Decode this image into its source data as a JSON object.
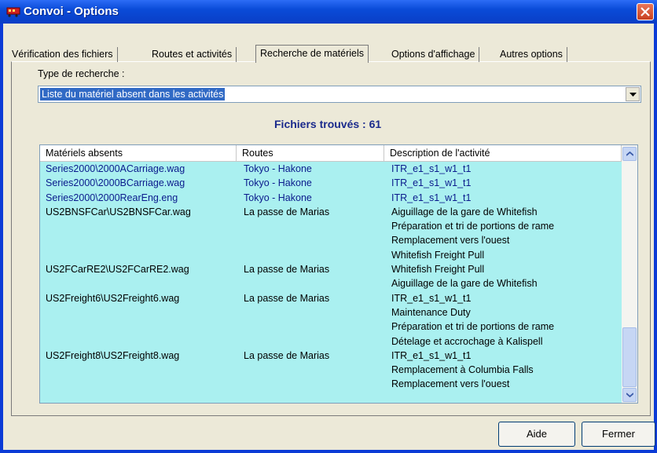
{
  "window": {
    "title": "Convoi - Options"
  },
  "tabs": [
    {
      "label": "Vérification des fichiers"
    },
    {
      "label": "Routes et activités"
    },
    {
      "label": "Recherche de matériels"
    },
    {
      "label": "Options d'affichage"
    },
    {
      "label": "Autres options"
    }
  ],
  "search": {
    "label": "Type de recherche :",
    "selected": "Liste du matériel absent dans les activités"
  },
  "result": {
    "found_text": "Fichiers trouvés : 61"
  },
  "table": {
    "headers": [
      "Matériels absents",
      "Routes",
      "Description de l'activité"
    ],
    "rows": [
      {
        "material": "Series2000\\2000ACarriage.wag",
        "route": "Tokyo - Hakone",
        "desc": "ITR_e1_s1_w1_t1"
      },
      {
        "material": "Series2000\\2000BCarriage.wag",
        "route": "Tokyo - Hakone",
        "desc": "ITR_e1_s1_w1_t1"
      },
      {
        "material": "Series2000\\2000RearEng.eng",
        "route": "Tokyo - Hakone",
        "desc": "ITR_e1_s1_w1_t1"
      },
      {
        "material": "US2BNSFCar\\US2BNSFCar.wag",
        "route": "La passe de Marias",
        "desc": "Aiguillage de la gare de Whitefish"
      },
      {
        "material": "",
        "route": "",
        "desc": "Préparation et tri de portions de rame"
      },
      {
        "material": "",
        "route": "",
        "desc": "Remplacement vers l'ouest"
      },
      {
        "material": "",
        "route": "",
        "desc": "Whitefish Freight Pull"
      },
      {
        "material": "US2FCarRE2\\US2FCarRE2.wag",
        "route": "La passe de Marias",
        "desc": "Whitefish Freight Pull"
      },
      {
        "material": "",
        "route": "",
        "desc": "Aiguillage de la gare de Whitefish"
      },
      {
        "material": "US2Freight6\\US2Freight6.wag",
        "route": "La passe de Marias",
        "desc": "ITR_e1_s1_w1_t1"
      },
      {
        "material": "",
        "route": "",
        "desc": "Maintenance Duty"
      },
      {
        "material": "",
        "route": "",
        "desc": "Préparation et tri de portions de rame"
      },
      {
        "material": "",
        "route": "",
        "desc": "Dételage et accrochage à Kalispell"
      },
      {
        "material": "US2Freight8\\US2Freight8.wag",
        "route": "La passe de Marias",
        "desc": "ITR_e1_s1_w1_t1"
      },
      {
        "material": "",
        "route": "",
        "desc": "Remplacement à Columbia Falls"
      },
      {
        "material": "",
        "route": "",
        "desc": "Remplacement vers l'ouest"
      }
    ]
  },
  "buttons": {
    "help": "Aide",
    "close": "Fermer"
  },
  "colors": {
    "titlebar": "#0a4bd8",
    "list_bg": "#aaf0f0",
    "selection": "#316ac5"
  }
}
